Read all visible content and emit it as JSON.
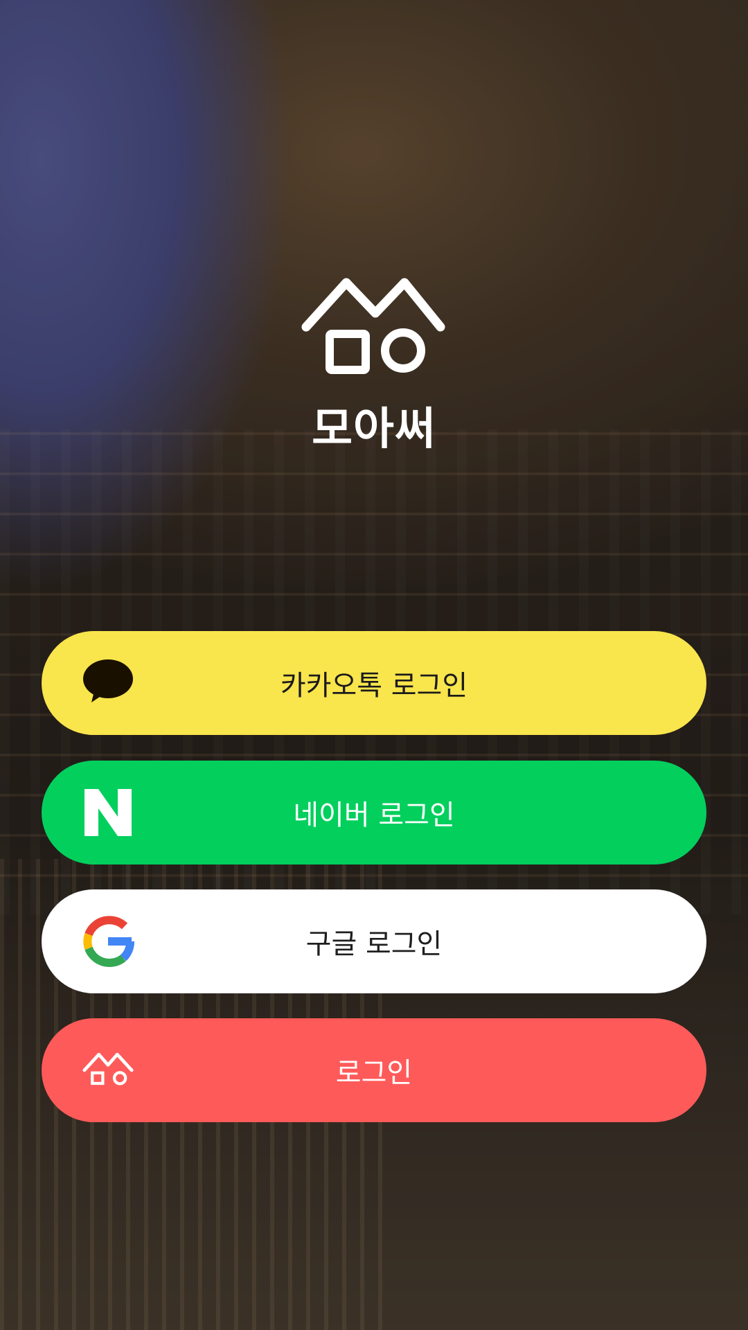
{
  "app": {
    "name": "모아써"
  },
  "login": {
    "kakao_label": "카카오톡 로그인",
    "naver_label": "네이버 로그인",
    "google_label": "구글 로그인",
    "app_label": "로그인"
  },
  "icons": {
    "logo": "moasseo-logo-icon",
    "kakao": "kakao-talk-bubble-icon",
    "naver": "naver-n-icon",
    "google": "google-g-icon",
    "app": "moasseo-logo-icon"
  },
  "colors": {
    "kakao": "#f9e54c",
    "naver": "#03cf5d",
    "google": "#ffffff",
    "app": "#ff5a5a",
    "text_dark": "#1b1b1b",
    "text_light": "#ffffff"
  }
}
